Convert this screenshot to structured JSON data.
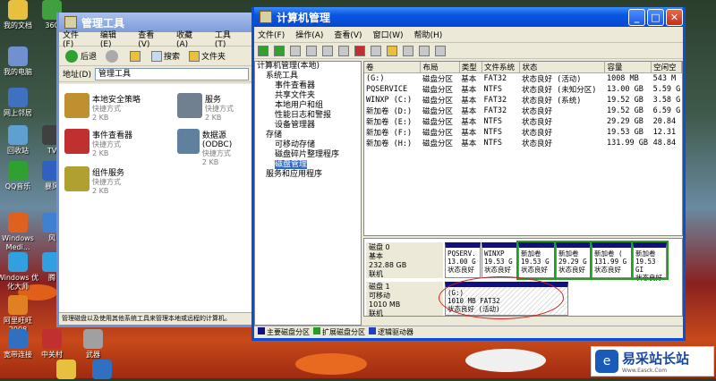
{
  "desktop_icons": [
    {
      "label": "我的文档",
      "color": "#e8c040"
    },
    {
      "label": "360",
      "color": "#40a040"
    },
    {
      "label": "我的电脑",
      "color": "#7090d0"
    },
    {
      "label": "网上邻居",
      "color": "#4070c0"
    },
    {
      "label": "回收站",
      "color": "#60a0d0"
    },
    {
      "label": "TV",
      "color": "#404040"
    },
    {
      "label": "QQ音乐",
      "color": "#30a030"
    },
    {
      "label": "暴风",
      "color": "#3060c0"
    },
    {
      "label": "Windows Medi...",
      "color": "#e06020"
    },
    {
      "label": "风",
      "color": "#4080d0"
    },
    {
      "label": "Windows 优化大师",
      "color": "#30a0e0"
    },
    {
      "label": "腾",
      "color": "#30a0e0"
    },
    {
      "label": "阿里旺旺 2008",
      "color": "#e08020"
    },
    {
      "label": "宽带连接",
      "color": "#3070c0"
    },
    {
      "label": "中关村",
      "color": "#c03030"
    },
    {
      "label": "武器",
      "color": "#a0a0a0"
    }
  ],
  "explorer": {
    "title": "管理工具",
    "menu": [
      "文件(F)",
      "编辑(E)",
      "查看(V)",
      "收藏(A)",
      "工具(T)",
      "帮助(H)"
    ],
    "toolbar": {
      "back": "后退",
      "search": "搜索",
      "folders": "文件夹"
    },
    "address_label": "地址(D)",
    "address_value": "管理工具",
    "items": [
      {
        "name": "本地安全策略",
        "type": "快捷方式",
        "size": "2 KB",
        "icon_color": "#c09030"
      },
      {
        "name": "服务",
        "type": "快捷方式",
        "size": "2 KB",
        "icon_color": "#708090"
      },
      {
        "name": "事件查看器",
        "type": "快捷方式",
        "size": "2 KB",
        "icon_color": "#c03030"
      },
      {
        "name": "数据源 (ODBC)",
        "type": "快捷方式",
        "size": "2 KB",
        "icon_color": "#6080a0"
      },
      {
        "name": "组件服务",
        "type": "快捷方式",
        "size": "2 KB",
        "icon_color": "#b0a030"
      }
    ],
    "status": "管理磁盘以及使用其他系统工具来管理本地或远程的计算机。"
  },
  "cm": {
    "title": "计算机管理",
    "menu": [
      "文件(F)",
      "操作(A)",
      "查看(V)",
      "窗口(W)",
      "帮助(H)"
    ],
    "tree": [
      {
        "label": "计算机管理(本地)",
        "indent": 0
      },
      {
        "label": "系统工具",
        "indent": 1
      },
      {
        "label": "事件查看器",
        "indent": 2
      },
      {
        "label": "共享文件夹",
        "indent": 2
      },
      {
        "label": "本地用户和组",
        "indent": 2
      },
      {
        "label": "性能日志和警报",
        "indent": 2
      },
      {
        "label": "设备管理器",
        "indent": 2
      },
      {
        "label": "存储",
        "indent": 1
      },
      {
        "label": "可移动存储",
        "indent": 2
      },
      {
        "label": "磁盘碎片整理程序",
        "indent": 2
      },
      {
        "label": "磁盘管理",
        "indent": 2,
        "selected": true
      },
      {
        "label": "服务和应用程序",
        "indent": 1
      }
    ],
    "columns": [
      "卷",
      "布局",
      "类型",
      "文件系统",
      "状态",
      "容量",
      "空闲空"
    ],
    "volumes": [
      [
        "(G:)",
        "磁盘分区",
        "基本",
        "FAT32",
        "状态良好 (活动)",
        "1008 MB",
        "543 M"
      ],
      [
        "PQSERVICE",
        "磁盘分区",
        "基本",
        "NTFS",
        "状态良好 (未知分区)",
        "13.00 GB",
        "5.59 G"
      ],
      [
        "WINXP (C:)",
        "磁盘分区",
        "基本",
        "FAT32",
        "状态良好 (系统)",
        "19.52 GB",
        "3.58 G"
      ],
      [
        "新加卷 (D:)",
        "磁盘分区",
        "基本",
        "FAT32",
        "状态良好",
        "19.52 GB",
        "6.59 G"
      ],
      [
        "新加卷 (E:)",
        "磁盘分区",
        "基本",
        "NTFS",
        "状态良好",
        "29.29 GB",
        "20.84"
      ],
      [
        "新加卷 (F:)",
        "磁盘分区",
        "基本",
        "NTFS",
        "状态良好",
        "19.53 GB",
        "12.31"
      ],
      [
        "新加卷 (H:)",
        "磁盘分区",
        "基本",
        "NTFS",
        "状态良好",
        "131.99 GB",
        "48.84"
      ]
    ],
    "disk0": {
      "name": "磁盘 0",
      "type": "基本",
      "size": "232.88 GB",
      "status": "联机",
      "parts": [
        {
          "name": "PQSERV.",
          "size": "13.00 G",
          "status": "状态良好"
        },
        {
          "name": "WINXP",
          "size": "19.53 G",
          "status": "状态良好"
        },
        {
          "name": "新加卷",
          "size": "19.53 G",
          "status": "状态良好"
        },
        {
          "name": "新加卷",
          "size": "29.29 G",
          "status": "状态良好"
        },
        {
          "name": "新加卷 (",
          "size": "131.99 G",
          "status": "状态良好"
        },
        {
          "name": "新加卷",
          "size": "19.53 GI",
          "status": "状态良好"
        }
      ]
    },
    "disk1": {
      "name": "磁盘 1",
      "type": "可移动",
      "size": "1010 MB",
      "status": "联机",
      "part": {
        "name": "(G:)",
        "size": "1010 MB FAT32",
        "status": "状态良好 (活动)"
      }
    },
    "legend": [
      "主要磁盘分区",
      "扩展磁盘分区",
      "逻辑驱动器"
    ],
    "legend_colors": [
      "#10107f",
      "#20a020",
      "#2040c0"
    ]
  },
  "logo": {
    "text": "易采站长站",
    "sub": "Www.Easck.Com"
  }
}
